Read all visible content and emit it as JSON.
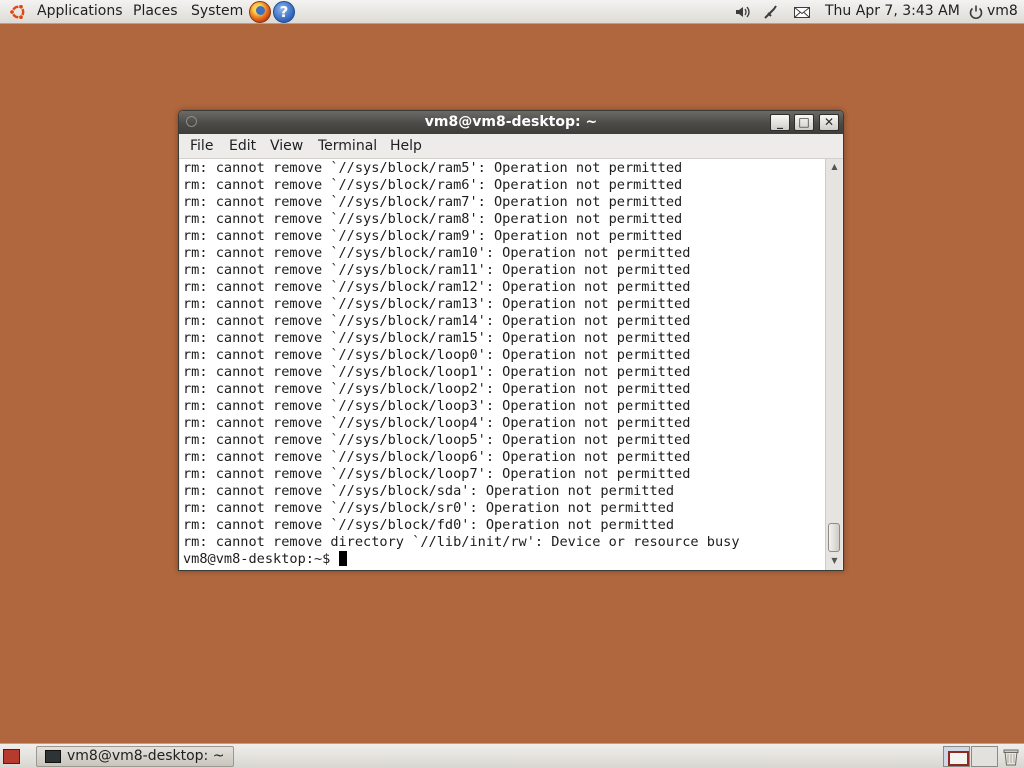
{
  "top_panel": {
    "menus": [
      "Applications",
      "Places",
      "System"
    ],
    "clock": "Thu Apr  7,  3:43 AM",
    "user": "vm8",
    "launchers": [
      "firefox-icon",
      "help-icon"
    ],
    "tray_icons": [
      "volume-icon",
      "network-icon",
      "mail-icon",
      "power-icon"
    ]
  },
  "window": {
    "title": "vm8@vm8-desktop: ~",
    "menu": [
      "File",
      "Edit",
      "View",
      "Terminal",
      "Help"
    ],
    "buttons": {
      "minimize": "_",
      "maximize": "□",
      "close": "✕"
    }
  },
  "terminal": {
    "lines": [
      "rm: cannot remove `//sys/block/ram5': Operation not permitted",
      "rm: cannot remove `//sys/block/ram6': Operation not permitted",
      "rm: cannot remove `//sys/block/ram7': Operation not permitted",
      "rm: cannot remove `//sys/block/ram8': Operation not permitted",
      "rm: cannot remove `//sys/block/ram9': Operation not permitted",
      "rm: cannot remove `//sys/block/ram10': Operation not permitted",
      "rm: cannot remove `//sys/block/ram11': Operation not permitted",
      "rm: cannot remove `//sys/block/ram12': Operation not permitted",
      "rm: cannot remove `//sys/block/ram13': Operation not permitted",
      "rm: cannot remove `//sys/block/ram14': Operation not permitted",
      "rm: cannot remove `//sys/block/ram15': Operation not permitted",
      "rm: cannot remove `//sys/block/loop0': Operation not permitted",
      "rm: cannot remove `//sys/block/loop1': Operation not permitted",
      "rm: cannot remove `//sys/block/loop2': Operation not permitted",
      "rm: cannot remove `//sys/block/loop3': Operation not permitted",
      "rm: cannot remove `//sys/block/loop4': Operation not permitted",
      "rm: cannot remove `//sys/block/loop5': Operation not permitted",
      "rm: cannot remove `//sys/block/loop6': Operation not permitted",
      "rm: cannot remove `//sys/block/loop7': Operation not permitted",
      "rm: cannot remove `//sys/block/sda': Operation not permitted",
      "rm: cannot remove `//sys/block/sr0': Operation not permitted",
      "rm: cannot remove `//sys/block/fd0': Operation not permitted",
      "rm: cannot remove directory `//lib/init/rw': Device or resource busy"
    ],
    "prompt": "vm8@vm8-desktop:~$ "
  },
  "bottom_panel": {
    "task_label": "vm8@vm8-desktop: ~"
  },
  "colors": {
    "desktop": "#b0673e",
    "titlebar": "#4b4a46",
    "terminal_bg": "#ffffff"
  }
}
